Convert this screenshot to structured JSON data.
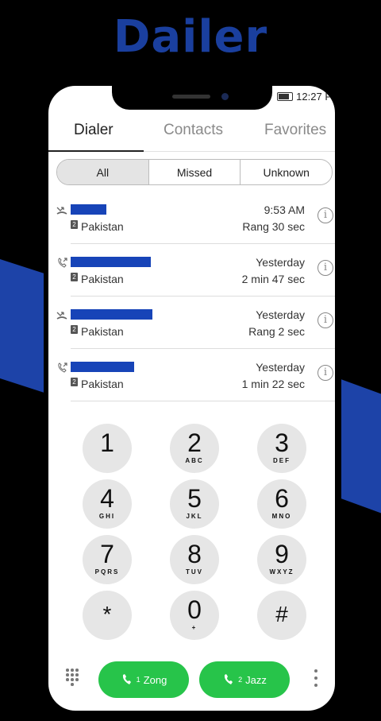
{
  "banner": {
    "title": "Dailer"
  },
  "status": {
    "time": "12:27 P"
  },
  "tabs": [
    {
      "label": "Dialer",
      "active": true
    },
    {
      "label": "Contacts",
      "active": false
    },
    {
      "label": "Favorites",
      "active": false
    }
  ],
  "filters": [
    {
      "label": "All",
      "selected": true
    },
    {
      "label": "Missed",
      "selected": false
    },
    {
      "label": "Unknown",
      "selected": false
    }
  ],
  "calls": [
    {
      "type": "missed-call-icon",
      "sim": "2",
      "country": "Pakistan",
      "when": "9:53 AM",
      "detail": "Rang 30 sec"
    },
    {
      "type": "outgoing-call-icon",
      "sim": "2",
      "country": "Pakistan",
      "when": "Yesterday",
      "detail": "2 min 47 sec"
    },
    {
      "type": "missed-call-icon",
      "sim": "2",
      "country": "Pakistan",
      "when": "Yesterday",
      "detail": "Rang 2 sec"
    },
    {
      "type": "outgoing-call-icon",
      "sim": "2",
      "country": "Pakistan",
      "when": "Yesterday",
      "detail": "1 min 22 sec"
    }
  ],
  "keypad": [
    {
      "digit": "1",
      "letters": ""
    },
    {
      "digit": "2",
      "letters": "ABC"
    },
    {
      "digit": "3",
      "letters": "DEF"
    },
    {
      "digit": "4",
      "letters": "GHI"
    },
    {
      "digit": "5",
      "letters": "JKL"
    },
    {
      "digit": "6",
      "letters": "MNO"
    },
    {
      "digit": "7",
      "letters": "PQRS"
    },
    {
      "digit": "8",
      "letters": "TUV"
    },
    {
      "digit": "9",
      "letters": "WXYZ"
    },
    {
      "digit": "*",
      "letters": ""
    },
    {
      "digit": "0",
      "letters": "+"
    },
    {
      "digit": "#",
      "letters": ""
    }
  ],
  "sim_buttons": [
    {
      "sim": "1",
      "label": "Zong"
    },
    {
      "sim": "2",
      "label": "Jazz"
    }
  ],
  "colors": {
    "accent_blue": "#1d43a8",
    "call_green": "#27c44a",
    "redaction": "#1744b8"
  }
}
